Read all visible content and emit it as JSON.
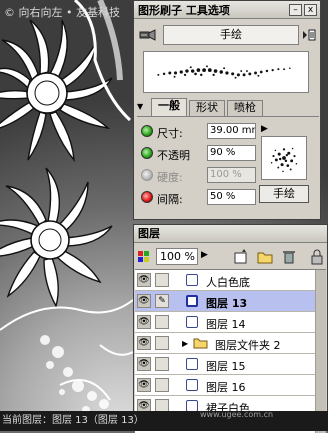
{
  "watermark": "© 向右向左 • 友基科技",
  "brush_panel": {
    "title": "图形刷子  工具选项",
    "minimize": "–",
    "close": "x",
    "preset": "手绘",
    "tabs": [
      {
        "label": "一般",
        "active": true
      },
      {
        "label": "形状",
        "active": false
      },
      {
        "label": "喷枪",
        "active": false
      }
    ],
    "props": [
      {
        "label": "尺寸:",
        "value": "39.00 mm",
        "status": "green",
        "enabled": true
      },
      {
        "label": "不透明",
        "value": "90 %",
        "status": "green",
        "enabled": true
      },
      {
        "label": "硬度:",
        "value": "100 %",
        "status": "gray",
        "enabled": false
      },
      {
        "label": "间隔:",
        "value": "50 %",
        "status": "red",
        "enabled": true
      }
    ],
    "preview_button": "手绘"
  },
  "layers_panel": {
    "title": "图层",
    "opacity": "100 %",
    "layers": [
      {
        "name": "人白色底",
        "selected": false,
        "type": "layer",
        "brush": false
      },
      {
        "name": "图层 13",
        "selected": true,
        "type": "layer",
        "brush": true
      },
      {
        "name": "图层 14",
        "selected": false,
        "type": "layer",
        "brush": false
      },
      {
        "name": "图层文件夹 2",
        "selected": false,
        "type": "folder",
        "brush": false
      },
      {
        "name": "图层 15",
        "selected": false,
        "type": "layer",
        "brush": false
      },
      {
        "name": "图层 16",
        "selected": false,
        "type": "layer",
        "brush": false
      },
      {
        "name": "裙子白色",
        "selected": false,
        "type": "layer",
        "brush": false
      }
    ]
  },
  "footer": {
    "text": "当前图层：图层 13（图层 13）",
    "site": "www.ugee.com.cn"
  },
  "colors": {
    "panel_bg": "#d4d0c8",
    "selected_row": "#b8c0f0",
    "status_green": "#24a114",
    "status_red": "#e01010"
  }
}
